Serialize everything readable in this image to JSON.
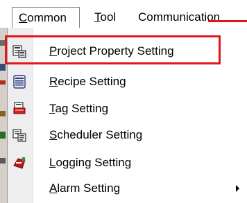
{
  "menubar": {
    "items": [
      {
        "label": "Common",
        "mnemonic": "C",
        "rest": "ommon"
      },
      {
        "label": "Tool",
        "mnemonic": "T",
        "rest": "ool"
      },
      {
        "label": "Communication",
        "mnemonic": "",
        "rest": "Communication"
      }
    ]
  },
  "dropdown": {
    "items": [
      {
        "label": "Project Property Setting",
        "mnemonic": "P",
        "rest": "roject Property Setting",
        "icon": "project-property-icon",
        "highlighted": true
      },
      {
        "label": "Recipe Setting",
        "mnemonic": "R",
        "rest": "ecipe Setting",
        "icon": "recipe-icon"
      },
      {
        "label": "Tag Setting",
        "mnemonic": "T",
        "rest": "ag Setting",
        "icon": "tag-icon"
      },
      {
        "label": "Scheduler Setting",
        "mnemonic": "S",
        "rest": "cheduler Setting",
        "icon": "scheduler-icon"
      },
      {
        "label": "Logging Setting",
        "mnemonic": "L",
        "rest": "ogging Setting",
        "icon": "logging-icon"
      },
      {
        "label": "Alarm Setting",
        "mnemonic": "A",
        "rest": "larm Setting",
        "icon": "alarm-icon",
        "has_submenu": true
      }
    ]
  },
  "colors": {
    "highlight_border": "#e0161c",
    "icon_column": "#eeeeee"
  }
}
